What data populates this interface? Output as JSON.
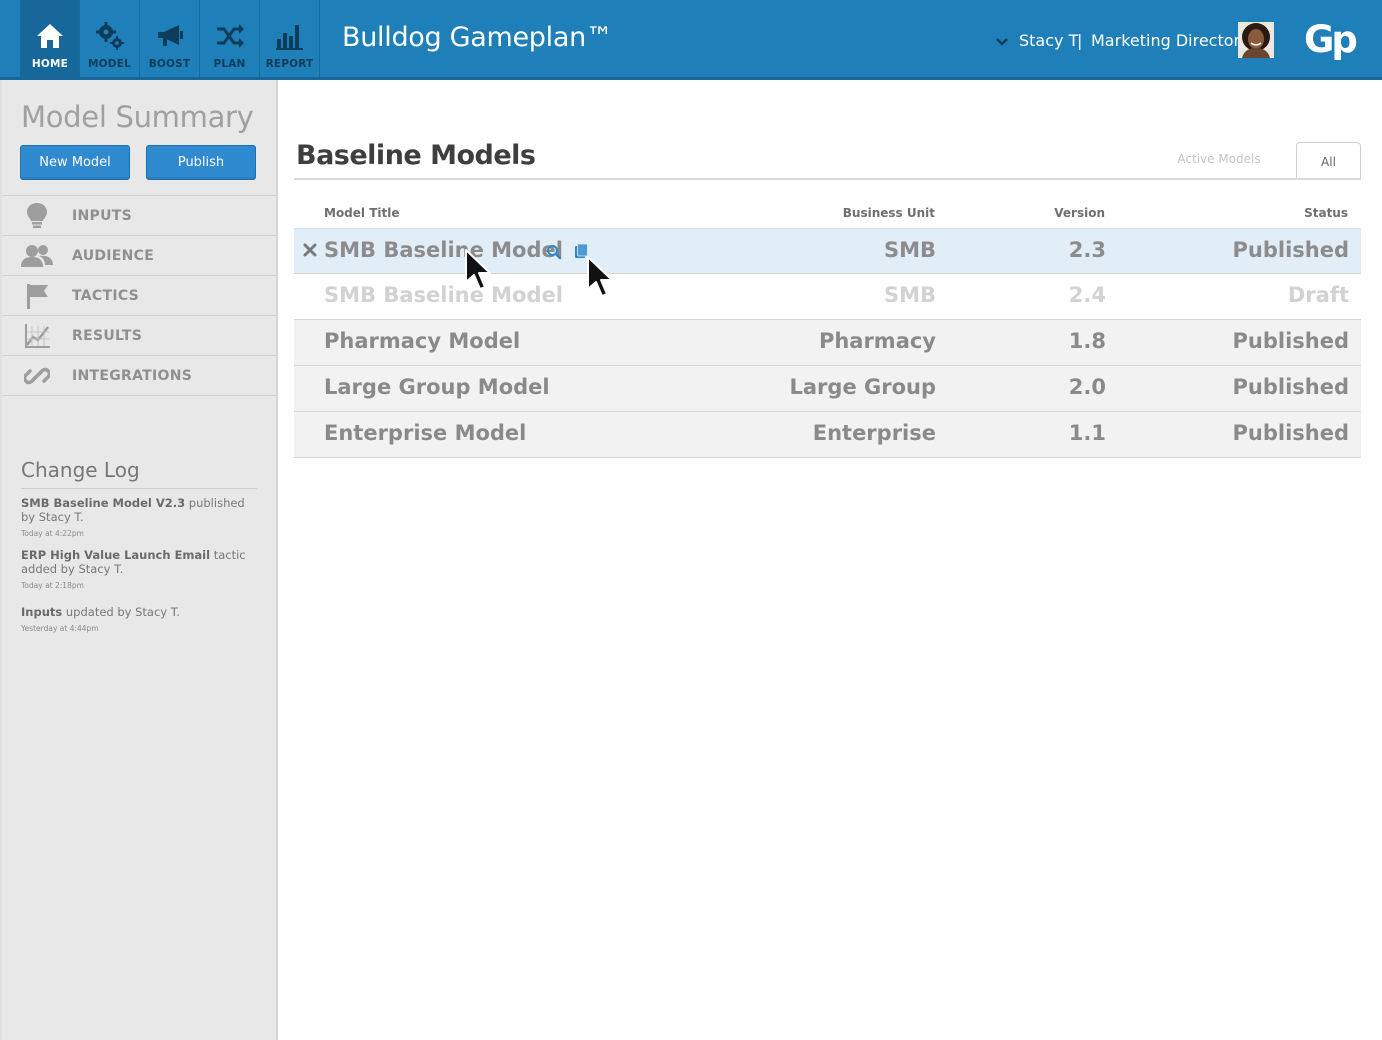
{
  "app": {
    "title": "Bulldog Gameplan™",
    "logo": "Gp",
    "accent_color": "#1f7fb8"
  },
  "nav": {
    "items": [
      {
        "label": "HOME",
        "icon": "home-icon",
        "active": true
      },
      {
        "label": "MODEL",
        "icon": "gears-icon",
        "active": false
      },
      {
        "label": "BOOST",
        "icon": "megaphone-icon",
        "active": false
      },
      {
        "label": "PLAN",
        "icon": "shuffle-icon",
        "active": false
      },
      {
        "label": "REPORT",
        "icon": "bar-chart-icon",
        "active": false
      }
    ]
  },
  "user": {
    "name": "Stacy T",
    "separator": "|",
    "role": "Marketing Director",
    "avatar_icon": "user-avatar"
  },
  "sidebar": {
    "title": "Model Summary",
    "new_model_label": "New Model",
    "publish_label": "Publish",
    "items": [
      {
        "label": "INPUTS",
        "icon": "lightbulb-icon"
      },
      {
        "label": "AUDIENCE",
        "icon": "users-icon"
      },
      {
        "label": "TACTICS",
        "icon": "flag-icon"
      },
      {
        "label": "RESULTS",
        "icon": "line-chart-icon"
      },
      {
        "label": "INTEGRATIONS",
        "icon": "link-icon"
      }
    ],
    "changelog": {
      "title": "Change Log",
      "entries": [
        {
          "subject": "SMB Baseline Model V2.3",
          "text": " published by Stacy T.",
          "time": "Today at 4:22pm"
        },
        {
          "subject": "ERP High Value Launch Email",
          "text": " tactic added by Stacy T.",
          "time": "Today at 2:18pm"
        },
        {
          "subject": "Inputs",
          "text": " updated by Stacy T.",
          "time": "Yesterday at 4:44pm"
        }
      ]
    }
  },
  "main": {
    "title": "Baseline Models",
    "tabs": {
      "active_models": "Active Models",
      "all": "All",
      "selected": "All"
    },
    "columns": {
      "title": "Model Title",
      "unit": "Business Unit",
      "version": "Version",
      "status": "Status"
    },
    "rows": [
      {
        "title": "SMB Baseline Model",
        "unit": "SMB",
        "version": "2.3",
        "status": "Published",
        "state": "selected"
      },
      {
        "title": "SMB Baseline Model",
        "unit": "SMB",
        "version": "2.4",
        "status": "Draft",
        "state": "faint"
      },
      {
        "title": "Pharmacy Model",
        "unit": "Pharmacy",
        "version": "1.8",
        "status": "Published",
        "state": "grey"
      },
      {
        "title": "Large Group Model",
        "unit": "Large Group",
        "version": "2.0",
        "status": "Published",
        "state": "grey"
      },
      {
        "title": "Enterprise Model",
        "unit": "Enterprise",
        "version": "1.1",
        "status": "Published",
        "state": "grey"
      }
    ],
    "row_icons": [
      "close-icon",
      "search-icon",
      "copy-icon"
    ]
  }
}
